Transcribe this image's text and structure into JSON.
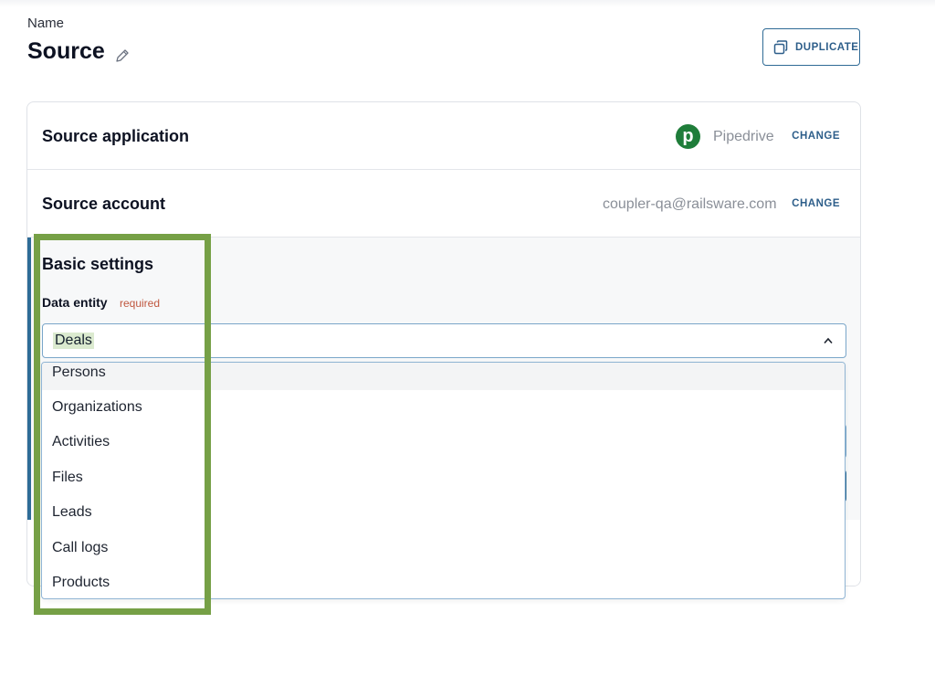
{
  "header": {
    "name_label": "Name",
    "title": "Source",
    "duplicate_label": "DUPLICATE"
  },
  "source_application": {
    "title": "Source application",
    "app_name": "Pipedrive",
    "logo_letter": "p",
    "change_label": "CHANGE"
  },
  "source_account": {
    "title": "Source account",
    "account_email": "coupler-qa@railsware.com",
    "change_label": "CHANGE"
  },
  "basic_settings": {
    "title": "Basic settings",
    "data_entity_label": "Data entity",
    "required_label": "required",
    "selected_value": "Deals",
    "options": [
      "Persons",
      "Organizations",
      "Activities",
      "Files",
      "Leads",
      "Call logs",
      "Products"
    ]
  },
  "colors": {
    "accent": "#2e6c97",
    "pipedrive_green": "#1f7d3a",
    "highlight_box": "#76a046",
    "required_red": "#c0573f"
  }
}
